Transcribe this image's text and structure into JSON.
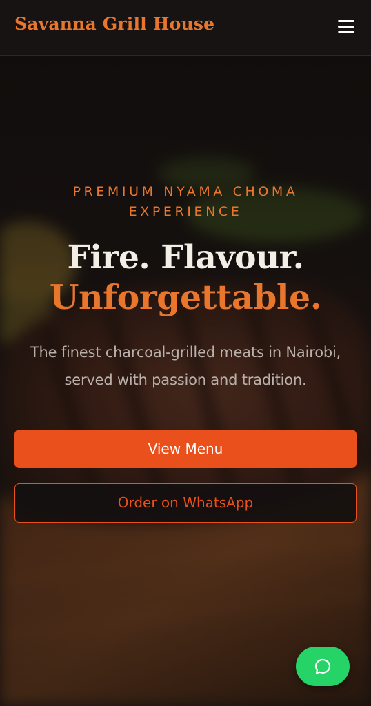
{
  "header": {
    "brand": "Savanna Grill House",
    "menu_icon": "hamburger-menu-icon"
  },
  "hero": {
    "eyebrow": "PREMIUM NYAMA CHOMA EXPERIENCE",
    "headline_line1": "Fire. Flavour.",
    "headline_line2": "Unforgettable.",
    "subtitle": "The finest charcoal-grilled meats in Nairobi, served with passion and tradition.",
    "primary_button": "View Menu",
    "secondary_button": "Order on WhatsApp",
    "background": "grilled-steak-photo"
  },
  "chat": {
    "icon": "chat-bubble-icon"
  },
  "colors": {
    "accent": "#e9762d",
    "primary_button": "#e9501b",
    "whatsapp": "#25d366",
    "header_bg": "#161312"
  }
}
